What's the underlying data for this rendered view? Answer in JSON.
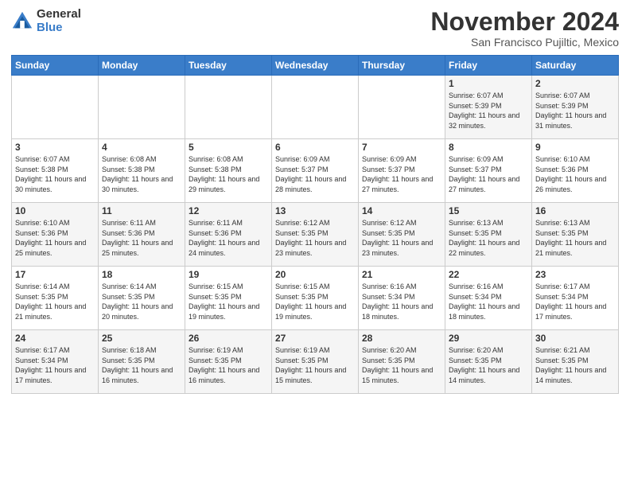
{
  "header": {
    "logo_general": "General",
    "logo_blue": "Blue",
    "month_title": "November 2024",
    "subtitle": "San Francisco Pujiltic, Mexico"
  },
  "days_of_week": [
    "Sunday",
    "Monday",
    "Tuesday",
    "Wednesday",
    "Thursday",
    "Friday",
    "Saturday"
  ],
  "weeks": [
    [
      {
        "day": "",
        "info": ""
      },
      {
        "day": "",
        "info": ""
      },
      {
        "day": "",
        "info": ""
      },
      {
        "day": "",
        "info": ""
      },
      {
        "day": "",
        "info": ""
      },
      {
        "day": "1",
        "info": "Sunrise: 6:07 AM\nSunset: 5:39 PM\nDaylight: 11 hours and 32 minutes."
      },
      {
        "day": "2",
        "info": "Sunrise: 6:07 AM\nSunset: 5:39 PM\nDaylight: 11 hours and 31 minutes."
      }
    ],
    [
      {
        "day": "3",
        "info": "Sunrise: 6:07 AM\nSunset: 5:38 PM\nDaylight: 11 hours and 30 minutes."
      },
      {
        "day": "4",
        "info": "Sunrise: 6:08 AM\nSunset: 5:38 PM\nDaylight: 11 hours and 30 minutes."
      },
      {
        "day": "5",
        "info": "Sunrise: 6:08 AM\nSunset: 5:38 PM\nDaylight: 11 hours and 29 minutes."
      },
      {
        "day": "6",
        "info": "Sunrise: 6:09 AM\nSunset: 5:37 PM\nDaylight: 11 hours and 28 minutes."
      },
      {
        "day": "7",
        "info": "Sunrise: 6:09 AM\nSunset: 5:37 PM\nDaylight: 11 hours and 27 minutes."
      },
      {
        "day": "8",
        "info": "Sunrise: 6:09 AM\nSunset: 5:37 PM\nDaylight: 11 hours and 27 minutes."
      },
      {
        "day": "9",
        "info": "Sunrise: 6:10 AM\nSunset: 5:36 PM\nDaylight: 11 hours and 26 minutes."
      }
    ],
    [
      {
        "day": "10",
        "info": "Sunrise: 6:10 AM\nSunset: 5:36 PM\nDaylight: 11 hours and 25 minutes."
      },
      {
        "day": "11",
        "info": "Sunrise: 6:11 AM\nSunset: 5:36 PM\nDaylight: 11 hours and 25 minutes."
      },
      {
        "day": "12",
        "info": "Sunrise: 6:11 AM\nSunset: 5:36 PM\nDaylight: 11 hours and 24 minutes."
      },
      {
        "day": "13",
        "info": "Sunrise: 6:12 AM\nSunset: 5:35 PM\nDaylight: 11 hours and 23 minutes."
      },
      {
        "day": "14",
        "info": "Sunrise: 6:12 AM\nSunset: 5:35 PM\nDaylight: 11 hours and 23 minutes."
      },
      {
        "day": "15",
        "info": "Sunrise: 6:13 AM\nSunset: 5:35 PM\nDaylight: 11 hours and 22 minutes."
      },
      {
        "day": "16",
        "info": "Sunrise: 6:13 AM\nSunset: 5:35 PM\nDaylight: 11 hours and 21 minutes."
      }
    ],
    [
      {
        "day": "17",
        "info": "Sunrise: 6:14 AM\nSunset: 5:35 PM\nDaylight: 11 hours and 21 minutes."
      },
      {
        "day": "18",
        "info": "Sunrise: 6:14 AM\nSunset: 5:35 PM\nDaylight: 11 hours and 20 minutes."
      },
      {
        "day": "19",
        "info": "Sunrise: 6:15 AM\nSunset: 5:35 PM\nDaylight: 11 hours and 19 minutes."
      },
      {
        "day": "20",
        "info": "Sunrise: 6:15 AM\nSunset: 5:35 PM\nDaylight: 11 hours and 19 minutes."
      },
      {
        "day": "21",
        "info": "Sunrise: 6:16 AM\nSunset: 5:34 PM\nDaylight: 11 hours and 18 minutes."
      },
      {
        "day": "22",
        "info": "Sunrise: 6:16 AM\nSunset: 5:34 PM\nDaylight: 11 hours and 18 minutes."
      },
      {
        "day": "23",
        "info": "Sunrise: 6:17 AM\nSunset: 5:34 PM\nDaylight: 11 hours and 17 minutes."
      }
    ],
    [
      {
        "day": "24",
        "info": "Sunrise: 6:17 AM\nSunset: 5:34 PM\nDaylight: 11 hours and 17 minutes."
      },
      {
        "day": "25",
        "info": "Sunrise: 6:18 AM\nSunset: 5:35 PM\nDaylight: 11 hours and 16 minutes."
      },
      {
        "day": "26",
        "info": "Sunrise: 6:19 AM\nSunset: 5:35 PM\nDaylight: 11 hours and 16 minutes."
      },
      {
        "day": "27",
        "info": "Sunrise: 6:19 AM\nSunset: 5:35 PM\nDaylight: 11 hours and 15 minutes."
      },
      {
        "day": "28",
        "info": "Sunrise: 6:20 AM\nSunset: 5:35 PM\nDaylight: 11 hours and 15 minutes."
      },
      {
        "day": "29",
        "info": "Sunrise: 6:20 AM\nSunset: 5:35 PM\nDaylight: 11 hours and 14 minutes."
      },
      {
        "day": "30",
        "info": "Sunrise: 6:21 AM\nSunset: 5:35 PM\nDaylight: 11 hours and 14 minutes."
      }
    ]
  ]
}
